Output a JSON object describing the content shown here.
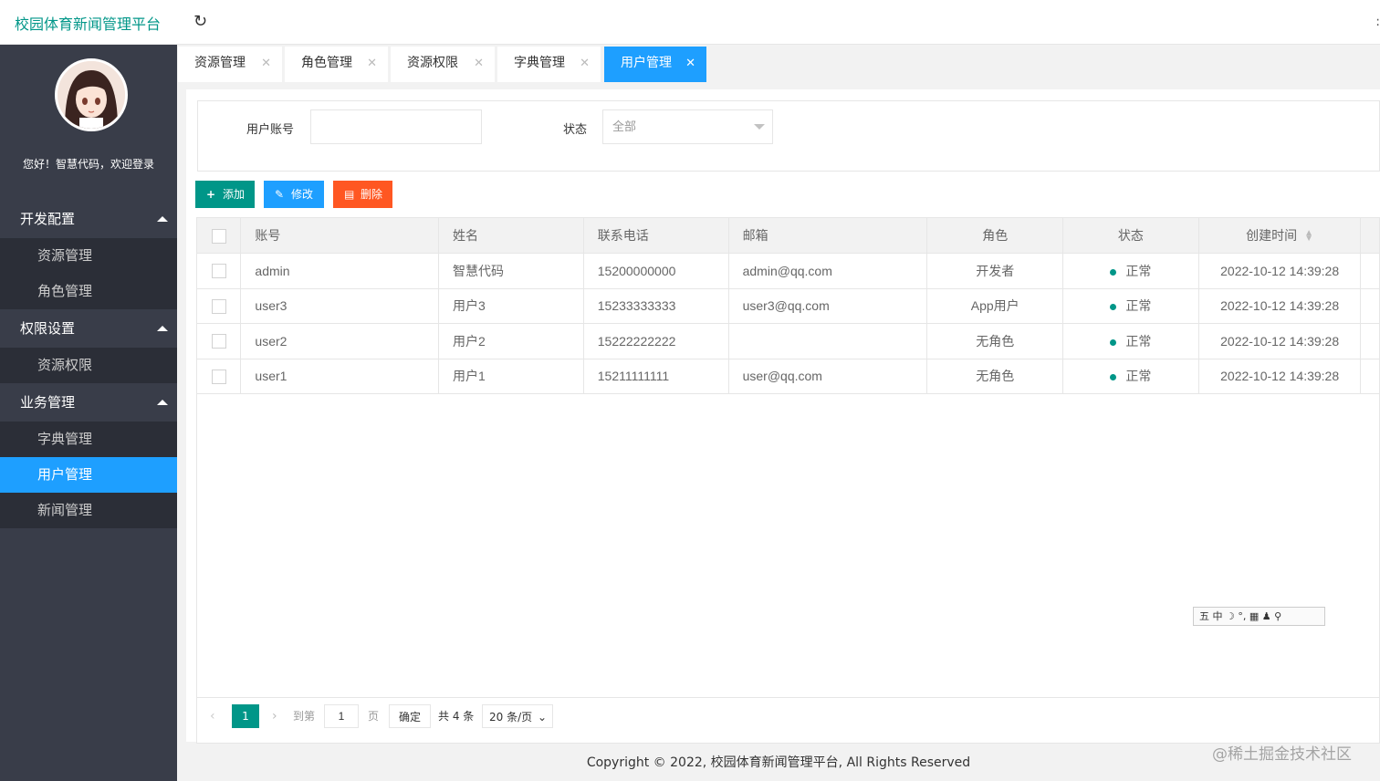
{
  "app": {
    "title": "校园体育新闻管理平台"
  },
  "header": {
    "refresh_icon": "refresh-icon"
  },
  "sidebar": {
    "welcome": "您好！智慧代码，欢迎登录",
    "groups": [
      {
        "title": "开发配置",
        "items": [
          "资源管理",
          "角色管理"
        ]
      },
      {
        "title": "权限设置",
        "items": [
          "资源权限"
        ]
      },
      {
        "title": "业务管理",
        "items": [
          "字典管理",
          "用户管理",
          "新闻管理"
        ]
      }
    ],
    "active_item": "用户管理"
  },
  "tabs": [
    {
      "label": "资源管理",
      "close": "✕"
    },
    {
      "label": "角色管理",
      "close": "✕"
    },
    {
      "label": "资源权限",
      "close": "✕"
    },
    {
      "label": "字典管理",
      "close": "✕"
    },
    {
      "label": "用户管理",
      "close": "✕"
    }
  ],
  "search": {
    "account_label": "用户账号",
    "account_value": "",
    "status_label": "状态",
    "status_selected": "全部"
  },
  "toolbar": {
    "add_label": "添加",
    "edit_label": "修改",
    "delete_label": "删除"
  },
  "table": {
    "columns": [
      "账号",
      "姓名",
      "联系电话",
      "邮箱",
      "角色",
      "状态",
      "创建时间"
    ],
    "rows": [
      {
        "account": "admin",
        "name": "智慧代码",
        "phone": "15200000000",
        "email": "admin@qq.com",
        "role": "开发者",
        "status": "正常",
        "created": "2022-10-12 14:39:28"
      },
      {
        "account": "user3",
        "name": "用户3",
        "phone": "15233333333",
        "email": "user3@qq.com",
        "role": "App用户",
        "status": "正常",
        "created": "2022-10-12 14:39:28"
      },
      {
        "account": "user2",
        "name": "用户2",
        "phone": "15222222222",
        "email": "",
        "role": "无角色",
        "status": "正常",
        "created": "2022-10-12 14:39:28"
      },
      {
        "account": "user1",
        "name": "用户1",
        "phone": "15211111111",
        "email": "user@qq.com",
        "role": "无角色",
        "status": "正常",
        "created": "2022-10-12 14:39:28"
      }
    ],
    "status_color": "#009688"
  },
  "pagination": {
    "current_page": "1",
    "goto_label": "到第",
    "goto_value": "1",
    "page_suffix": "页",
    "confirm_label": "确定",
    "total_label": "共 4 条",
    "page_size": "20 条/页"
  },
  "ime_toolbar": "五 中 ☽ °, ▦ ♟ ⚲",
  "footer": {
    "copyright": "Copyright © 2022, 校园体育新闻管理平台, All Rights Reserved"
  },
  "watermark": "@稀土掘金技术社区",
  "colors": {
    "primary": "#009688",
    "blue": "#1e9fff",
    "danger": "#ff5722",
    "sidebar": "#393d49"
  }
}
